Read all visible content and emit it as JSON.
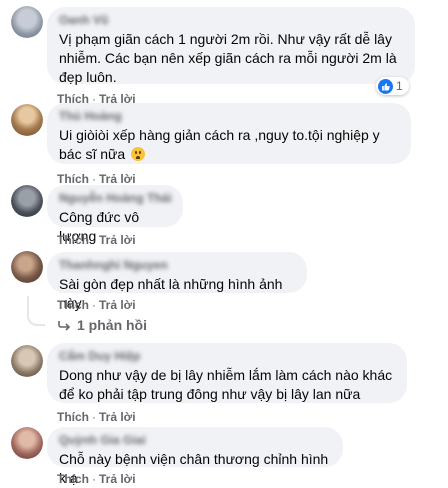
{
  "comments": [
    {
      "author": "Oanh Vũ",
      "text": "Vị phạm giãn cách 1 người 2m rồi. Như vậy rất dễ lây nhiễm. Các bạn nên xếp giãn cách ra mỗi người 2m là đẹp luôn.",
      "like_label": "Thích",
      "reply_label": "Trả lời",
      "reactions": "1"
    },
    {
      "author": "Thủ Hoàng",
      "text": "Ui giòiòi xếp hàng giản cách ra ,nguy to.tội nghiệp y bác sĩ nữa",
      "like_label": "Thích",
      "reply_label": "Trả lời"
    },
    {
      "author": "Nguyễn Hoàng Thái",
      "text": "Công đức vô lượng",
      "like_label": "Thích",
      "reply_label": "Trả lời"
    },
    {
      "author": "Thanhnghi Nguyen",
      "text": "Sài gòn đẹp nhất là những hình ảnh này",
      "like_label": "Thích",
      "reply_label": "Trả lời",
      "replies_label": "1 phản hồi"
    },
    {
      "author": "Cẩm Duy Hiệp",
      "text": "Dong như vậy de bị lây nhiễm lắm làm cách nào khác để ko phải tập trung đông như vậy bị lây lan nữa",
      "like_label": "Thích",
      "reply_label": "Trả lời"
    },
    {
      "author": "Quỳnh Gia Giai",
      "text": "Chỗ này bệnh viện chân thương chỉnh hình k ạ",
      "like_label": "Thích",
      "reply_label": "Trả lời"
    }
  ],
  "colors": {
    "bubble": "#f0f2f5",
    "meta_text": "#65676b",
    "like_blue": "#1877f2"
  },
  "icons": {
    "like": "like-reaction-icon",
    "emoji": "sad-face-emoji",
    "reply_arrow": "reply-arrow-icon"
  }
}
